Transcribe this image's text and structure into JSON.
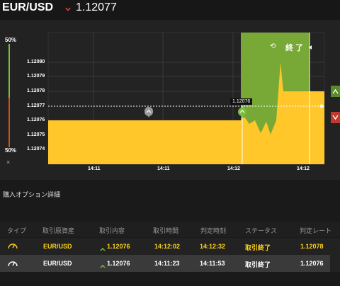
{
  "header": {
    "pair": "EUR/USD",
    "price": "1.12077",
    "direction": "down",
    "direction_color": "#e23a3a"
  },
  "sidebar": {
    "top_pct": "50%",
    "bottom_pct": "50%",
    "close": "×",
    "up_color": "#78c03c",
    "down_color": "#d84a1a"
  },
  "chart": {
    "y_ticks": [
      "1.12080",
      "1.12079",
      "1.12078",
      "1.12077",
      "1.12076",
      "1.12075",
      "1.12074"
    ],
    "x_ticks": [
      "14:11",
      "14:11",
      "14:12",
      "14:12"
    ],
    "current_price": "1.12076",
    "end_label": "終 了",
    "fill_color": "#ffc72a",
    "zone_color": "#78a836"
  },
  "details": {
    "title": "購入オプション詳細",
    "columns": [
      "タイプ",
      "取引原資産",
      "取引内容",
      "取引時間",
      "判定時刻",
      "ステータス",
      "判定レート"
    ],
    "rows": [
      {
        "asset": "EUR/USD",
        "content": "1.12076",
        "time": "14:12:02",
        "judge_time": "14:12:32",
        "status": "取引終了",
        "rate": "1.12078",
        "color": "#ffd21a"
      },
      {
        "asset": "EUR/USD",
        "content": "1.12076",
        "time": "14:11:23",
        "judge_time": "14:11:53",
        "status": "取引終了",
        "rate": "1.12076",
        "color": "#ffffff"
      }
    ]
  }
}
